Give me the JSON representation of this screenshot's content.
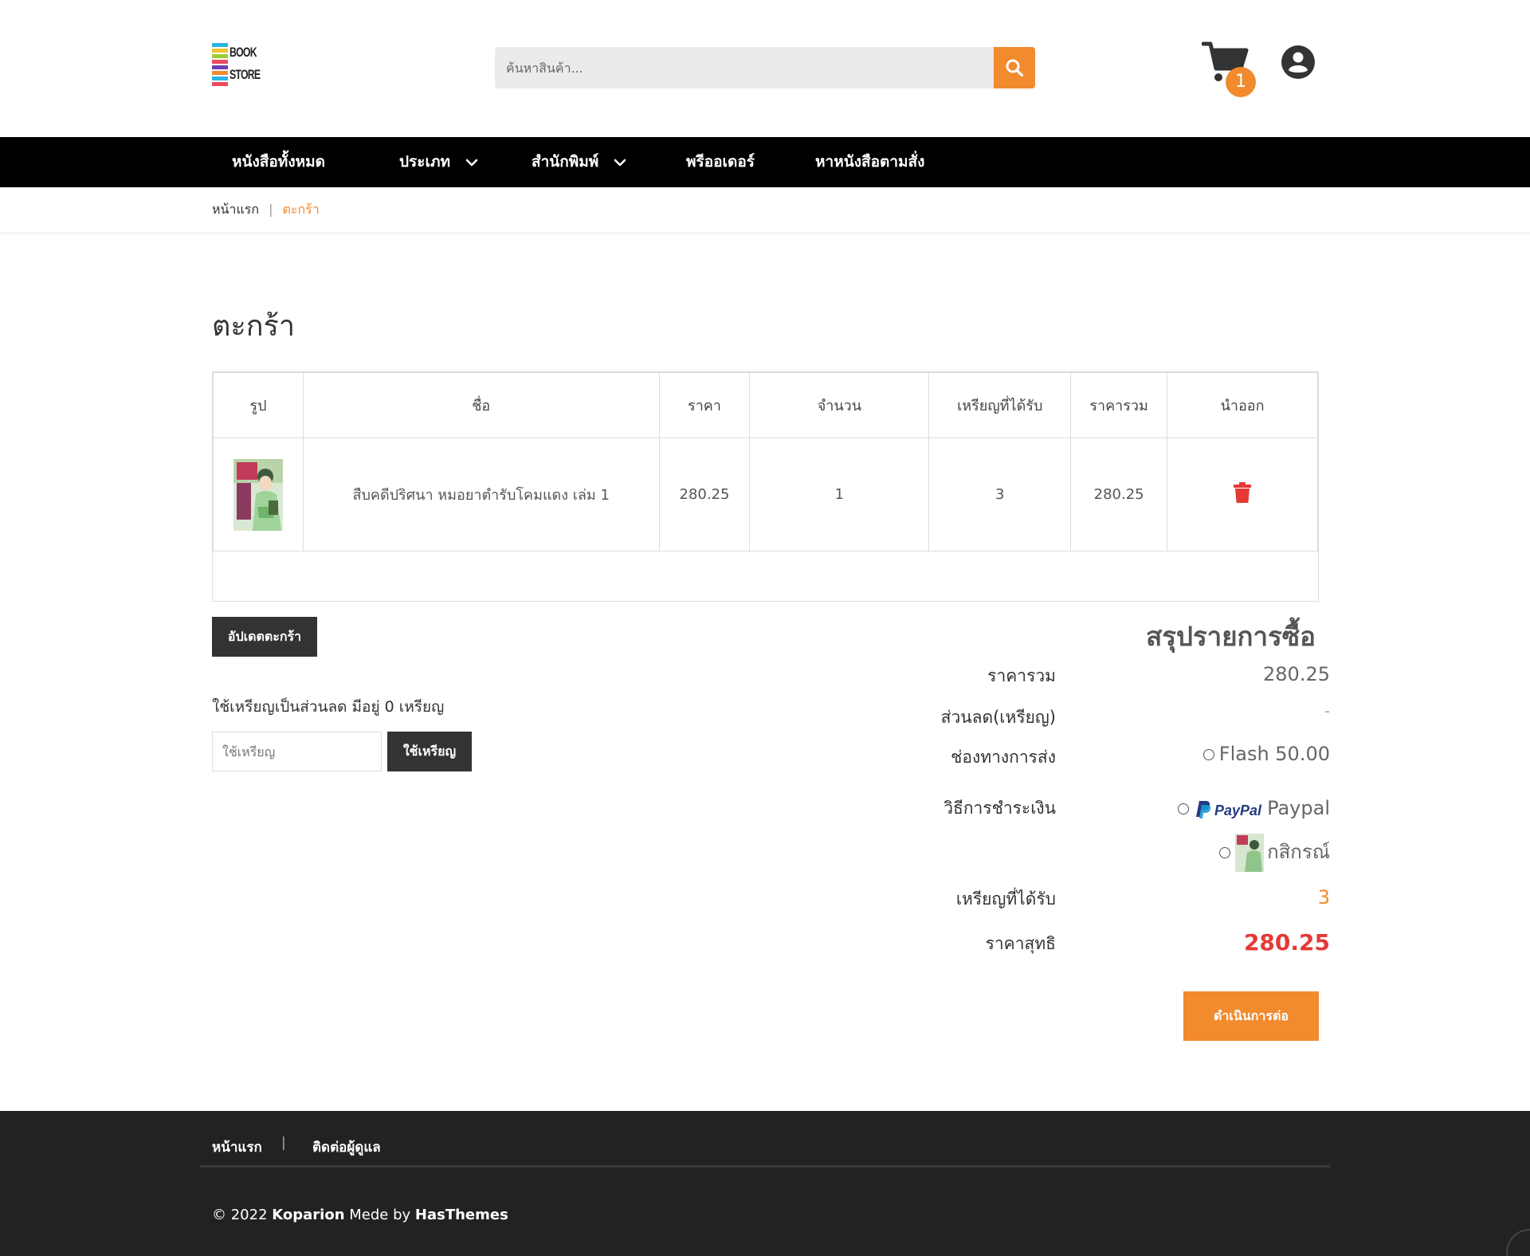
{
  "header": {
    "logo_text_1": "BOOK",
    "logo_text_2": "STORE",
    "search_placeholder": "ค้นหาสินค้า...",
    "cart_count": "1"
  },
  "nav": {
    "items": [
      {
        "label": "หนังสือทั้งหมด"
      },
      {
        "label": "ประเภท"
      },
      {
        "label": "สำนักพิมพ์"
      },
      {
        "label": "พรีออเดอร์"
      },
      {
        "label": "หาหนังสือตามสั่ง"
      }
    ]
  },
  "breadcrumb": {
    "home": "หน้าแรก",
    "separator": "|",
    "current": "ตะกร้า"
  },
  "page_title": "ตะกร้า",
  "cart_table": {
    "headers": [
      "รูป",
      "ชื่อ",
      "ราคา",
      "จำนวน",
      "เหรียญที่ได้รับ",
      "ราคารวม",
      "นำออก"
    ],
    "rows": [
      {
        "name": "สืบคดีปริศนา หมอยาตำรับโคมแดง เล่ม 1",
        "price": "280.25",
        "quantity": "1",
        "coins": "3",
        "total": "280.25"
      }
    ]
  },
  "update_cart_label": "อัปเดตตะกร้า",
  "coins": {
    "label": "ใช้เหรียญเป็นส่วนลด มีอยู่ 0 เหรียญ",
    "input_placeholder": "ใช้เหรียญ",
    "button_label": "ใช้เหรียญ"
  },
  "summary": {
    "title": "สรุปรายการซื้อ",
    "subtotal_label": "ราคารวม",
    "subtotal_value": "280.25",
    "discount_label": "ส่วนลด(เหรียญ)",
    "discount_value": "-",
    "shipping_label": "ช่องทางการส่ง",
    "shipping_option": "Flash 50.00",
    "payment_label": "วิธีการชำระเงิน",
    "payment_paypal_logo": "PayPal",
    "payment_paypal": "Paypal",
    "payment_kbank": "กสิกรณ์",
    "coins_label": "เหรียญที่ได้รับ",
    "coins_value": "3",
    "net_label": "ราคาสุทธิ",
    "net_value": "280.25",
    "proceed_label": "ดำเนินการต่อ"
  },
  "footer": {
    "link_home": "หน้าแรก",
    "separator": "|",
    "link_contact": "ติดต่อผู้ดูแล",
    "copyright_prefix": "© 2022",
    "copyright_brand": "Koparion",
    "copyright_mid": "Mede by",
    "copyright_author": "HasThemes"
  },
  "colors": {
    "accent": "#f28a2e",
    "nav_bg": "#000000",
    "footer_bg": "#222222",
    "danger": "#e53935",
    "button_dark": "#333333"
  },
  "icons": [
    "search-icon",
    "cart-icon",
    "user-icon",
    "chevron-down-icon",
    "trash-icon",
    "paypal-logo",
    "scroll-top-icon"
  ]
}
